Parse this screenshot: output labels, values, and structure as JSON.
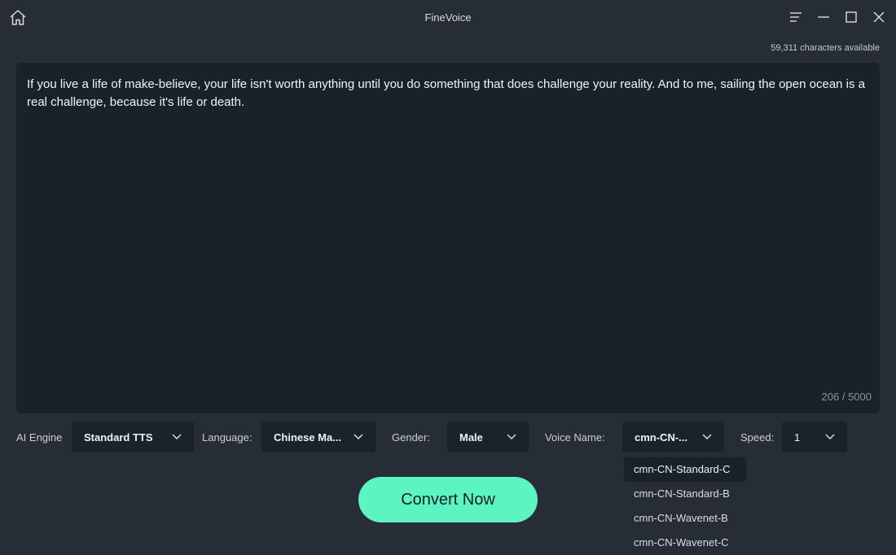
{
  "window": {
    "title": "FineVoice",
    "home_icon": "home-icon",
    "menu_icon": "menu-icon",
    "minimize_icon": "minimize-icon",
    "maximize_icon": "maximize-icon",
    "close_icon": "close-icon"
  },
  "credits": {
    "available_text": "59,311 characters available"
  },
  "editor": {
    "text": "If you live a life of make-believe, your life isn't worth anything until you do something that does challenge your reality. And to me, sailing the open ocean is a real challenge, because it's life or death.",
    "char_count": "206 / 5000"
  },
  "controls": {
    "ai_engine": {
      "label": "AI Engine",
      "value": "Standard TTS"
    },
    "language": {
      "label": "Language:",
      "value": "Chinese Ma..."
    },
    "gender": {
      "label": "Gender:",
      "value": "Male"
    },
    "voice_name": {
      "label": "Voice Name:",
      "value": "cmn-CN-..."
    },
    "speed": {
      "label": "Speed:",
      "value": "1"
    }
  },
  "convert_button": {
    "label": "Convert Now"
  },
  "voice_dropdown": {
    "options": [
      "cmn-CN-Standard-C",
      "cmn-CN-Standard-B",
      "cmn-CN-Wavenet-B",
      "cmn-CN-Wavenet-C"
    ],
    "selected": "cmn-CN-Standard-C"
  },
  "colors": {
    "background": "#262d37",
    "panel": "#19212b",
    "accent": "#5cf5c2"
  }
}
